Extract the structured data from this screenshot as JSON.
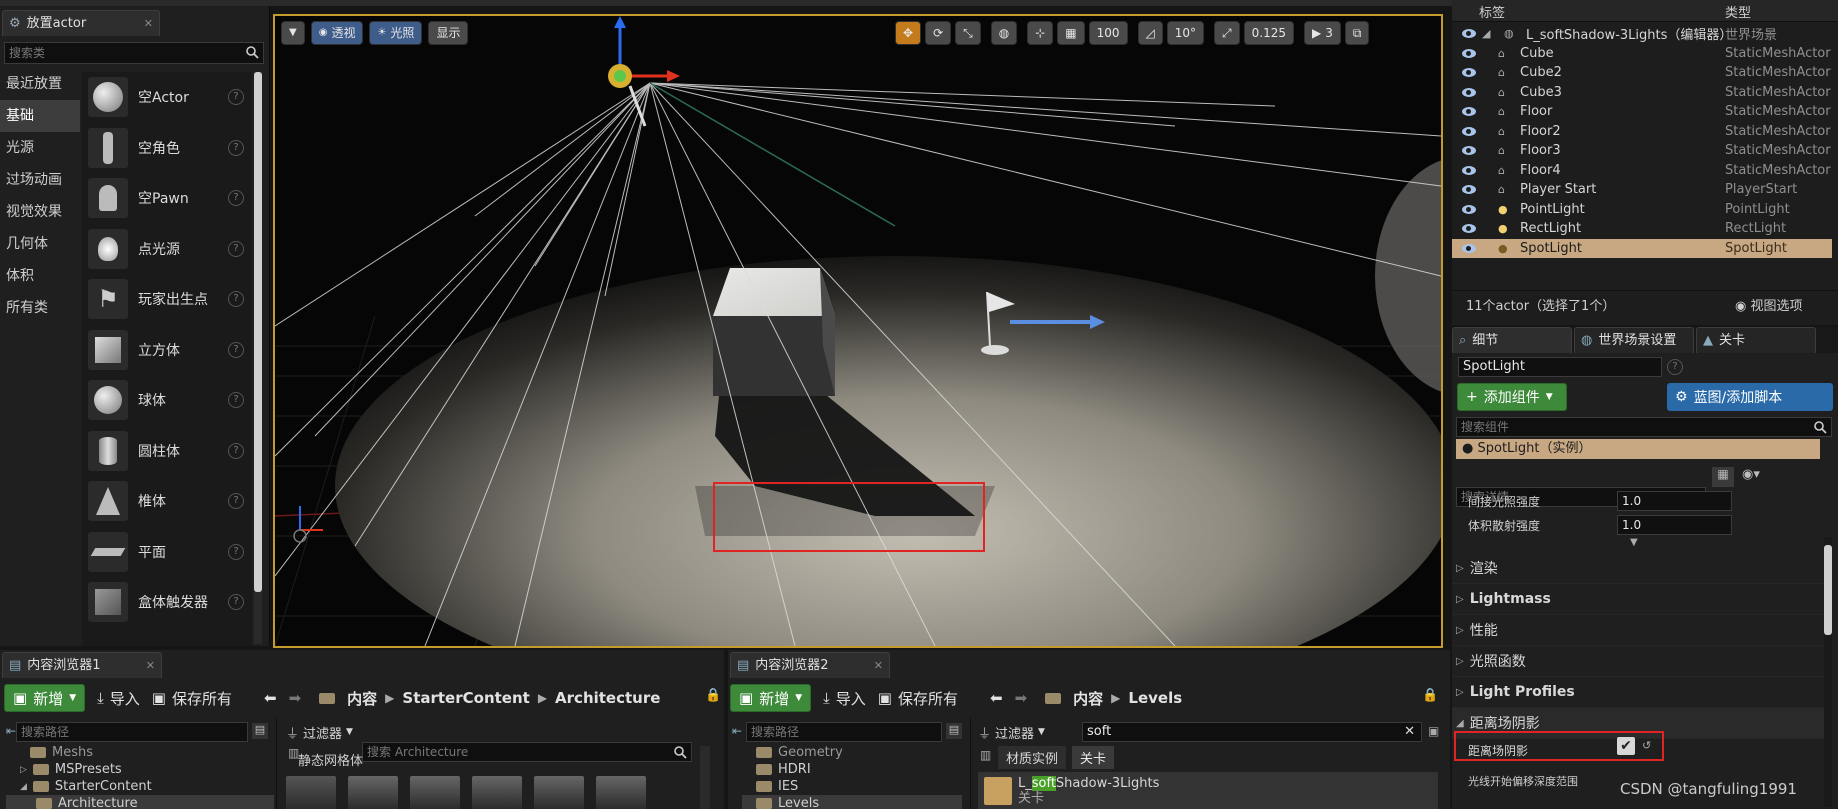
{
  "place_panel": {
    "tab_title": "放置actor",
    "search_placeholder": "搜索类",
    "categories": [
      "最近放置",
      "基础",
      "光源",
      "过场动画",
      "视觉效果",
      "几何体",
      "体积",
      "所有类"
    ],
    "selected_category": "基础",
    "items": [
      "空Actor",
      "空角色",
      "空Pawn",
      "点光源",
      "玩家出生点",
      "立方体",
      "球体",
      "圆柱体",
      "椎体",
      "平面",
      "盒体触发器"
    ]
  },
  "viewport": {
    "buttons": [
      "透视",
      "光照",
      "显示"
    ],
    "grid_snap": "100",
    "rot_snap": "10°",
    "scale_snap": "0.125",
    "camera_speed": "3"
  },
  "outliner": {
    "col_label": "标签",
    "col_type": "类型",
    "rows": [
      {
        "name": "L_softShadow-3Lights（编辑器）",
        "type": "世界场景",
        "indent": 0
      },
      {
        "name": "Cube",
        "type": "StaticMeshActor",
        "indent": 1
      },
      {
        "name": "Cube2",
        "type": "StaticMeshActor",
        "indent": 1
      },
      {
        "name": "Cube3",
        "type": "StaticMeshActor",
        "indent": 1
      },
      {
        "name": "Floor",
        "type": "StaticMeshActor",
        "indent": 1
      },
      {
        "name": "Floor2",
        "type": "StaticMeshActor",
        "indent": 1
      },
      {
        "name": "Floor3",
        "type": "StaticMeshActor",
        "indent": 1
      },
      {
        "name": "Floor4",
        "type": "StaticMeshActor",
        "indent": 1
      },
      {
        "name": "Player Start",
        "type": "PlayerStart",
        "indent": 1
      },
      {
        "name": "PointLight",
        "type": "PointLight",
        "indent": 1
      },
      {
        "name": "RectLight",
        "type": "RectLight",
        "indent": 1
      },
      {
        "name": "SpotLight",
        "type": "SpotLight",
        "indent": 1
      }
    ],
    "selected": "SpotLight",
    "status": "11个actor（选择了1个）",
    "view_options": "视图选项"
  },
  "details": {
    "tabs": [
      "细节",
      "世界场景设置",
      "关卡"
    ],
    "actor_name": "SpotLight",
    "add_component": "添加组件",
    "blueprint_btn": "蓝图/添加脚本",
    "search_components": "搜索组件",
    "component_instance": "SpotLight（实例）",
    "search_details": "搜索详情",
    "props": [
      {
        "label": "间接光照强度",
        "value": "1.0"
      },
      {
        "label": "体积散射强度",
        "value": "1.0"
      }
    ],
    "sections": [
      "渲染",
      "Lightmass",
      "性能",
      "光照函数",
      "Light Profiles",
      "距离场阴影"
    ],
    "df_shadow_label": "距离场阴影",
    "trace_offset_label": "光线开始偏移深度范围"
  },
  "cb1": {
    "tab": "内容浏览器1",
    "add": "新增",
    "import": "导入",
    "save_all": "保存所有",
    "path": [
      "内容",
      "StarterContent",
      "Architecture"
    ],
    "search_path": "搜索路径",
    "filter": "过滤器",
    "search_asset": "搜索 Architecture",
    "asset_group": "静态网格体",
    "tree": [
      "Meshs",
      "MSPresets",
      "StarterContent",
      "Architecture"
    ]
  },
  "cb2": {
    "tab": "内容浏览器2",
    "add": "新增",
    "import": "导入",
    "save_all": "保存所有",
    "path": [
      "内容",
      "Levels"
    ],
    "search_path": "搜索路径",
    "filter": "过滤器",
    "search_value": "soft",
    "chips": [
      "材质实例",
      "关卡"
    ],
    "tree": [
      "Geometry",
      "HDRI",
      "IES",
      "Levels"
    ],
    "asset_name_prefix": "L_",
    "asset_name_hl": "soft",
    "asset_name_suffix": "Shadow-3Lights",
    "asset_type": "关卡"
  },
  "watermark": "CSDN @tangfuling1991"
}
